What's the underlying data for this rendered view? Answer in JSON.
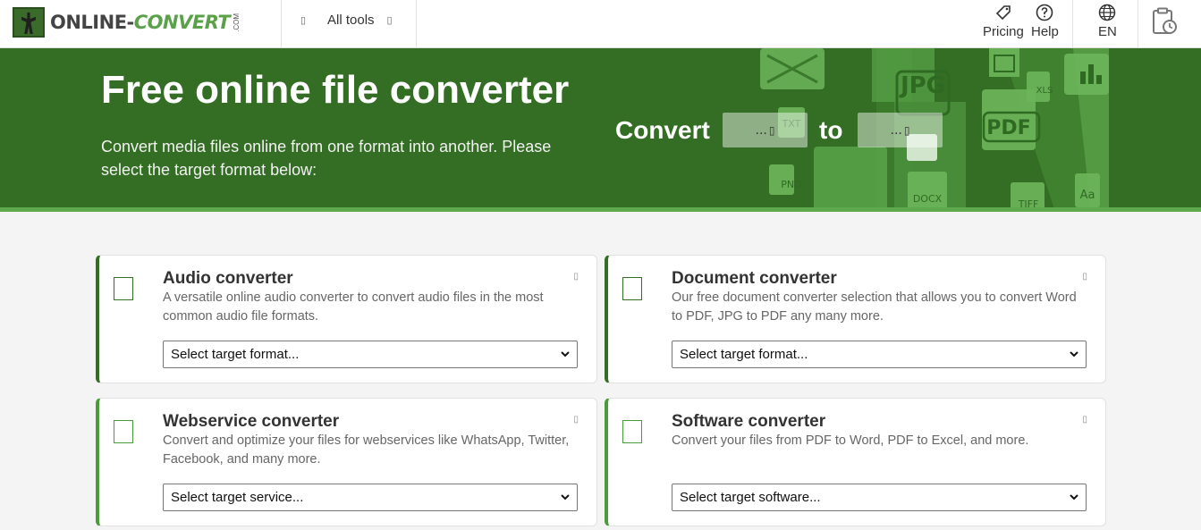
{
  "header": {
    "logo_text_main": "ONLINE-",
    "logo_text_accent": "CONVERT",
    "logo_com": ".COM",
    "all_tools": "All tools",
    "pricing": "Pricing",
    "help": "Help",
    "language": "EN"
  },
  "hero": {
    "title": "Free online file converter",
    "subtitle": "Convert media files online from one format into another. Please select the target format below:",
    "convert_label": "Convert",
    "to_label": "to",
    "from_placeholder": "...",
    "to_placeholder": "..."
  },
  "cards": [
    {
      "title": "Audio converter",
      "desc": "A versatile online audio converter to convert audio files in the most common audio file formats.",
      "select": "Select target format..."
    },
    {
      "title": "Document converter",
      "desc": "Our free document converter selection that allows you to convert Word to PDF, JPG to PDF any many more.",
      "select": "Select target format..."
    },
    {
      "title": "Webservice converter",
      "desc": "Convert and optimize your files for webservices like WhatsApp, Twitter, Facebook, and many more.",
      "select": "Select target service..."
    },
    {
      "title": "Software converter",
      "desc": "Convert your files from PDF to Word, PDF to Excel, and more.",
      "select": "Select target software..."
    }
  ],
  "deco_labels": [
    "TXT",
    "JPG",
    "XLS",
    "PDF",
    "PNG",
    "DOCX",
    "TIFF",
    "Aa"
  ],
  "colors": {
    "brand_dark": "#346d24",
    "brand_light": "#5ea94c"
  }
}
